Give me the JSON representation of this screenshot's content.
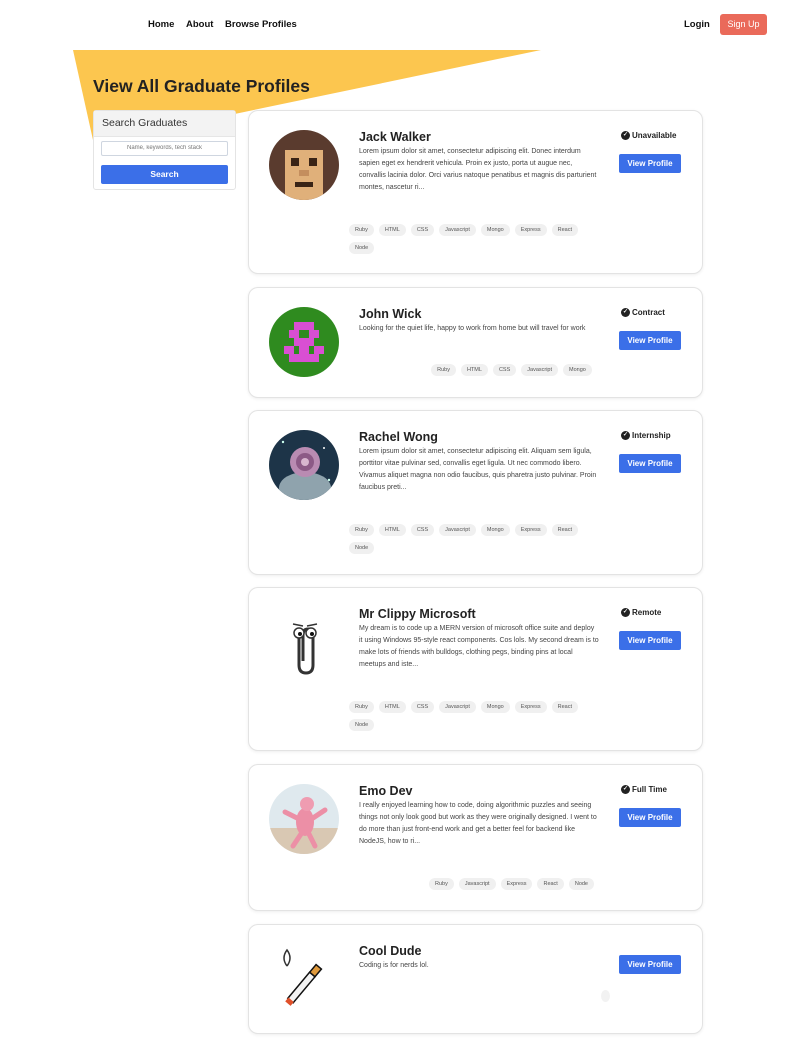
{
  "nav": {
    "home": "Home",
    "about": "About",
    "browse": "Browse Profiles",
    "login": "Login",
    "signup": "Sign Up"
  },
  "page": {
    "title": "View All Graduate Profiles"
  },
  "search": {
    "header": "Search Graduates",
    "placeholder": "Name, keywords, tech stack",
    "button": "Search"
  },
  "colors": {
    "banner": "#fcc64f",
    "primary_button": "#3b6fe8",
    "signup_button": "#ea6a5a"
  },
  "profiles": [
    {
      "name": "Jack Walker",
      "bio": "Lorem ipsum dolor sit amet, consectetur adipiscing elit. Donec interdum sapien eget ex hendrerit vehicula. Proin ex justo, porta ut augue nec, convallis lacinia dolor. Orci varius natoque penatibus et magnis dis parturient montes, nascetur ri...",
      "status": "Unavailable",
      "view": "View Profile",
      "tags": [
        "Ruby",
        "HTML",
        "CSS",
        "Javascript",
        "Mongo",
        "Express",
        "React",
        "Node"
      ],
      "avatar": "pixel-face"
    },
    {
      "name": "John Wick",
      "bio": "Looking for the quiet life, happy to work from home but will travel for work",
      "status": "Contract",
      "view": "View Profile",
      "tags": [
        "Ruby",
        "HTML",
        "CSS",
        "Javascript",
        "Mongo"
      ],
      "avatar": "pixel-invader"
    },
    {
      "name": "Rachel Wong",
      "bio": "Lorem ipsum dolor sit amet, consectetur adipiscing elit. Aliquam sem ligula, porttitor vitae pulvinar sed, convallis eget ligula. Ut nec commodo libero. Vivamus aliquet magna non odio faucibus, quis pharetra justo pulvinar. Proin faucibus preti...",
      "status": "Internship",
      "view": "View Profile",
      "tags": [
        "Ruby",
        "HTML",
        "CSS",
        "Javascript",
        "Mongo",
        "Express",
        "React",
        "Node"
      ],
      "avatar": "cosmic-figure"
    },
    {
      "name": "Mr Clippy Microsoft",
      "bio": "My dream is to code up a MERN version of microsoft office suite and deploy it using Windows 95-style react components. Cos lols. My second dream is to make lots of friends with bulldogs, clothing pegs, binding pins at local meetups and iste...",
      "status": "Remote",
      "view": "View Profile",
      "tags": [
        "Ruby",
        "HTML",
        "CSS",
        "Javascript",
        "Mongo",
        "Express",
        "React",
        "Node"
      ],
      "avatar": "paperclip"
    },
    {
      "name": "Emo Dev",
      "bio": "I really enjoyed learning how to code, doing algorithmic puzzles and seeing things not only look good but work as they were originally designed. I went to do more than just front-end work and get a better feel for backend like NodeJS, how to ri...",
      "status": "Full Time",
      "view": "View Profile",
      "tags": [
        "Ruby",
        "Javascript",
        "Express",
        "React",
        "Node"
      ],
      "avatar": "pink-creature"
    },
    {
      "name": "Cool Dude",
      "bio": "Coding is for nerds lol.",
      "status": "",
      "view": "View Profile",
      "tags": [],
      "avatar": "pixel-cigarette"
    }
  ]
}
